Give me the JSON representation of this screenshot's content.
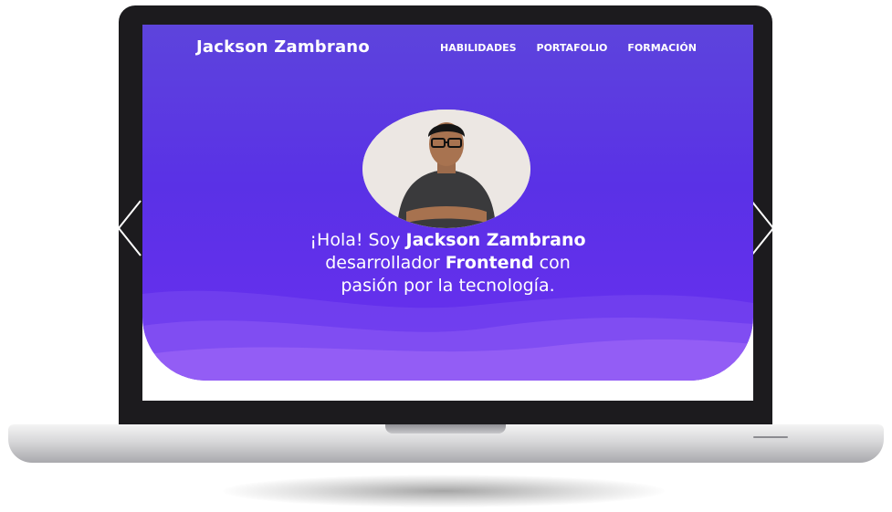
{
  "site": {
    "brand": "Jackson Zambrano",
    "nav": [
      {
        "label": "HABILIDADES"
      },
      {
        "label": "PORTAFOLIO"
      },
      {
        "label": "FORMACIÓN"
      }
    ]
  },
  "hero": {
    "greeting": "¡Hola! Soy ",
    "name": "Jackson Zambrano",
    "role_prefix": "desarrollador ",
    "role": "Frontend",
    "role_suffix": " con",
    "tagline": "pasión por la tecnología."
  },
  "icons": {
    "profile_photo": "person-photo-icon",
    "left_arrow": "chevron-left-icon",
    "right_arrow": "chevron-right-icon"
  },
  "colors": {
    "hero_top": "#5d44dc",
    "hero_bottom": "#6a2ff0",
    "bezel": "#1c1b1e",
    "text": "#ffffff"
  }
}
